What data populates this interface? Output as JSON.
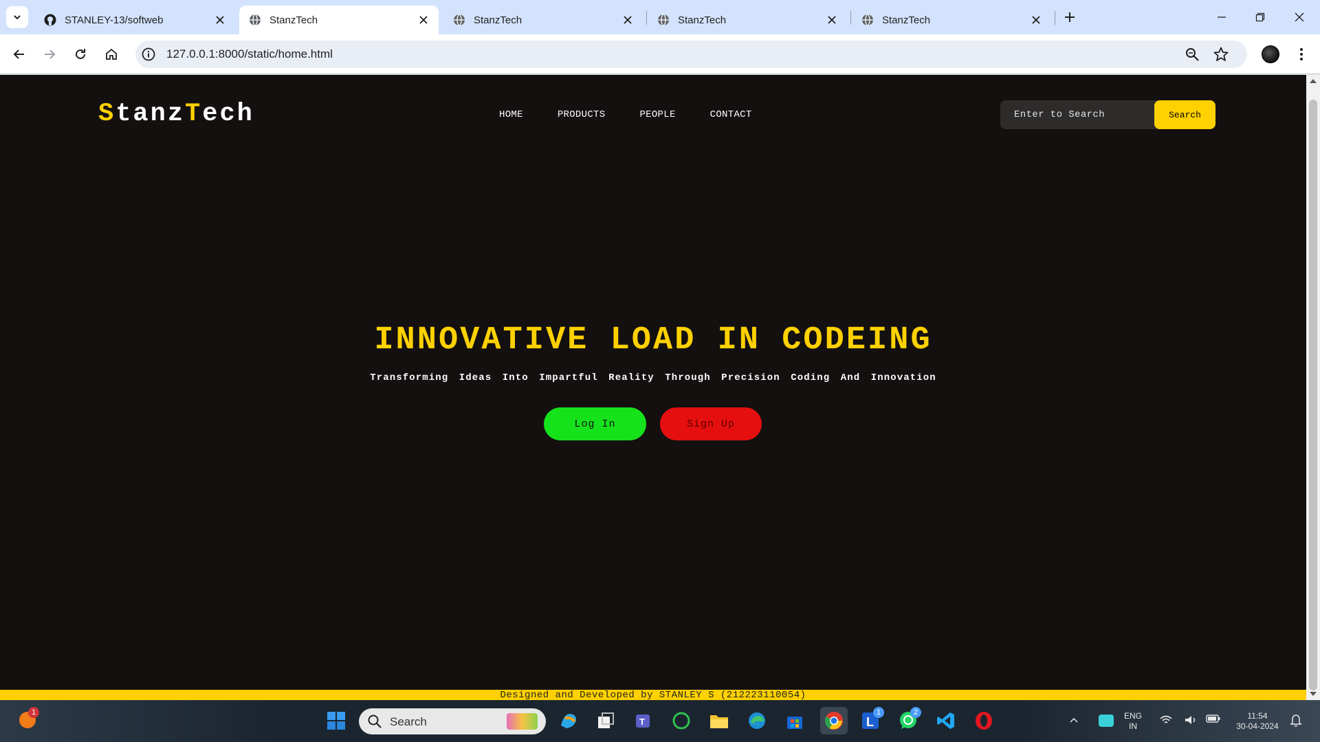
{
  "browser": {
    "tabs": [
      {
        "title": "STANLEY-13/softweb",
        "favicon": "github-icon",
        "active": false
      },
      {
        "title": "StanzTech",
        "favicon": "globe-icon",
        "active": true
      },
      {
        "title": "StanzTech",
        "favicon": "globe-icon",
        "active": false
      },
      {
        "title": "StanzTech",
        "favicon": "globe-icon",
        "active": false
      },
      {
        "title": "StanzTech",
        "favicon": "globe-icon",
        "active": false
      }
    ],
    "url": "127.0.0.1:8000/static/home.html"
  },
  "site": {
    "logo": {
      "part1": "S",
      "part2": "tanz",
      "part3": "T",
      "part4": "ech"
    },
    "nav": [
      "HOME",
      "PRODUCTS",
      "PEOPLE",
      "CONTACT"
    ],
    "search": {
      "placeholder": "Enter to Search",
      "button": "Search"
    },
    "hero": {
      "title": "INNOVATIVE LOAD IN CODEING",
      "subtitle": "Transforming Ideas Into Impartful Reality Through Precision Coding And Innovation",
      "login_label": "Log In",
      "signup_label": "Sign Up"
    },
    "footer": "Designed and Developed by STANLEY S (212223110054)",
    "colors": {
      "accent": "#ffd100",
      "background": "#141010",
      "login": "#15e21a",
      "signup": "#e60f0f"
    }
  },
  "taskbar": {
    "weather_badge": "1",
    "search_label": "Search",
    "apps": [
      "windows-start-icon",
      "copilot-icon",
      "task-view-icon",
      "teams-icon",
      "circle-app-icon",
      "file-explorer-icon",
      "edge-icon",
      "store-icon",
      "chrome-icon",
      "l-app-icon",
      "whatsapp-icon",
      "vscode-icon",
      "opera-icon"
    ],
    "l_app_badge": "1",
    "whatsapp_badge": "2",
    "language": {
      "line1": "ENG",
      "line2": "IN"
    },
    "clock": {
      "time": "11:54",
      "date": "30-04-2024"
    }
  }
}
